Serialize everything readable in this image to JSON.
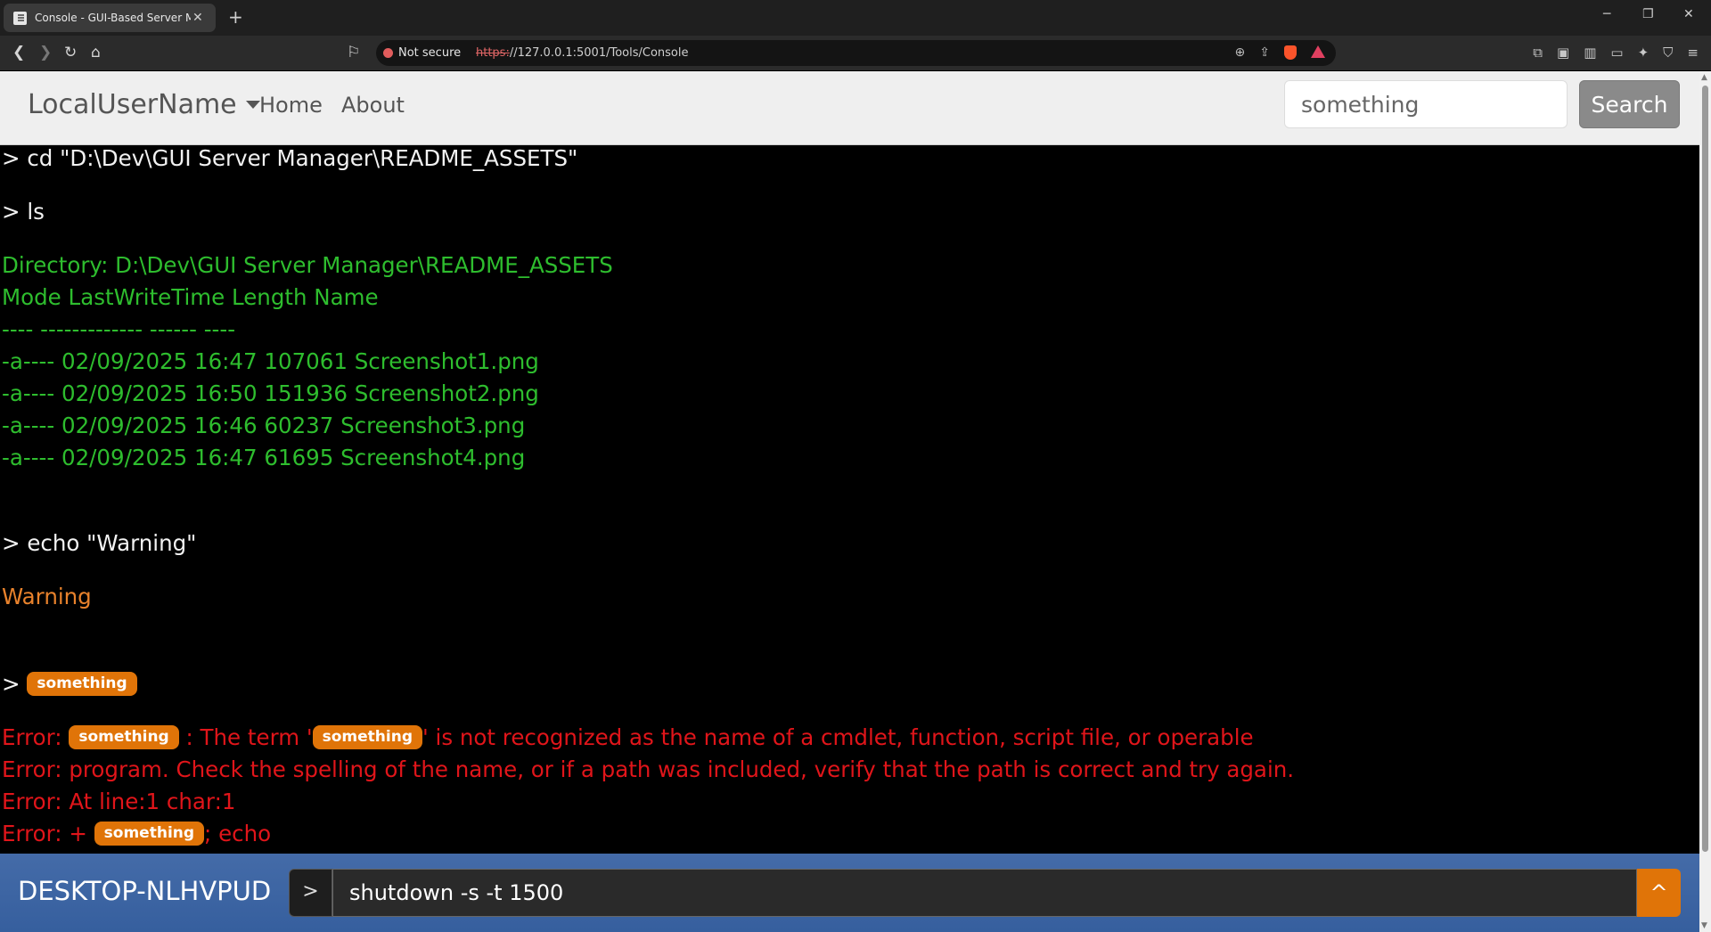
{
  "browser": {
    "tab_title": "Console - GUI-Based Server Manager",
    "new_tab_symbol": "+",
    "close_symbol": "✕",
    "security_label": "Not secure",
    "url_protocol": "https:",
    "url_rest": "//127.0.0.1:5001/Tools/Console"
  },
  "navbar": {
    "brand": "LocalUserName",
    "links": [
      "Home",
      "About"
    ],
    "search_value": "something",
    "search_button": "Search"
  },
  "console": {
    "lines": [
      {
        "type": "cmd",
        "text": "> cd \"D:\\Dev\\GUI Server Manager\\README_ASSETS\""
      },
      {
        "type": "cmd",
        "text": "> ls"
      },
      {
        "type": "out",
        "text": "Directory: D:\\Dev\\GUI Server Manager\\README_ASSETS"
      },
      {
        "type": "out",
        "text": "Mode LastWriteTime Length Name"
      },
      {
        "type": "out",
        "text": "---- ------------- ------ ----"
      },
      {
        "type": "out",
        "text": "-a---- 02/09/2025 16:47 107061 Screenshot1.png"
      },
      {
        "type": "out",
        "text": "-a---- 02/09/2025 16:50 151936 Screenshot2.png"
      },
      {
        "type": "out",
        "text": "-a---- 02/09/2025 16:46 60237 Screenshot3.png"
      },
      {
        "type": "out",
        "text": "-a---- 02/09/2025 16:47 61695 Screenshot4.png"
      },
      {
        "type": "cmd",
        "text": "> echo \"Warning\""
      },
      {
        "type": "warn",
        "text": "Warning"
      }
    ],
    "highlight_term": "something",
    "prompt_symbol": ">",
    "error_prefix": "Error:",
    "error_line1_mid": ": The term '",
    "error_line1_end": "' is not recognized as the name of a cmdlet, function, script file, or operable",
    "error_line2": "program. Check the spelling of the name, or if a path was included, verify that the path is correct and try again.",
    "error_line3": "At line:1 char:1",
    "error_line4_start": "+",
    "error_line4_end": "; echo"
  },
  "input_bar": {
    "hostname": "DESKTOP-NLHVPUD",
    "prompt": ">",
    "command_value": "shutdown -s -t 1500",
    "send_symbol": "^"
  }
}
